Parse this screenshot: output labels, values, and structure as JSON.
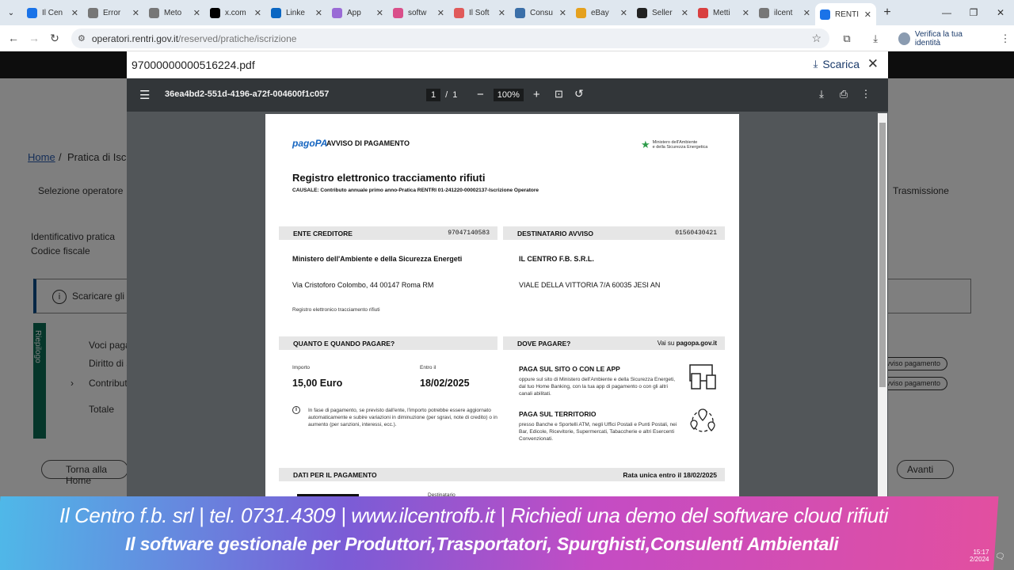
{
  "browser": {
    "tabs": [
      {
        "label": "Il Cen",
        "icon": "globe-icon",
        "color": "#1a73e8"
      },
      {
        "label": "Error",
        "icon": "globe-icon",
        "color": "#777777"
      },
      {
        "label": "Meto",
        "icon": "globe-icon",
        "color": "#777777"
      },
      {
        "label": "x.com",
        "icon": "x-logo-icon",
        "color": "#000000"
      },
      {
        "label": "Linke",
        "icon": "linkedin-icon",
        "color": "#0a66c2"
      },
      {
        "label": "App",
        "icon": "app-icon",
        "color": "#9a6bd6"
      },
      {
        "label": "softw",
        "icon": "flag-icon",
        "color": "#d94f8a"
      },
      {
        "label": "Il Soft",
        "icon": "search-icon",
        "color": "#e05a5a"
      },
      {
        "label": "Consu",
        "icon": "wordpress-icon",
        "color": "#3b6fa8"
      },
      {
        "label": "eBay",
        "icon": "ebay-icon",
        "color": "#e5a11e"
      },
      {
        "label": "Seller",
        "icon": "amazon-icon",
        "color": "#222222"
      },
      {
        "label": "Metti",
        "icon": "pin-icon",
        "color": "#d94040"
      },
      {
        "label": "ilcent",
        "icon": "globe-icon",
        "color": "#777777"
      },
      {
        "label": "RENTI",
        "icon": "link-icon",
        "color": "#1a73e8",
        "active": true
      }
    ],
    "url_host": "operatori.rentri.gov.it",
    "url_path": "/reserved/pratiche/iscrizione",
    "verify_label": "Verifica la tua identità"
  },
  "background_page": {
    "breadcrumb_home": "Home",
    "breadcrumb_current": "Pratica di Iscr",
    "step_1": "Selezione operatore",
    "step_last": "Trasmissione",
    "field_1": "Identificativo pratica",
    "field_2": "Codice fiscale",
    "info_text": "Scaricare gli a",
    "side_tab": "Riepilogo",
    "row_1": "Voci paga",
    "row_2": "Diritto di s",
    "row_3": "Contribut",
    "row_4": "Totale",
    "pill_1": "vviso pagamento",
    "pill_2": "vviso pagamento",
    "back_btn": "Torna alla Home",
    "next_btn": "Avanti"
  },
  "viewer": {
    "filename": "97000000000516224.pdf",
    "download_label": "Scarica",
    "doc_id": "36ea4bd2-551d-4196-a72f-004600f1c057",
    "page_current": "1",
    "page_total": "1",
    "zoom": "100%"
  },
  "document": {
    "logo": "pagoPA",
    "header_title": "AVVISO DI PAGAMENTO",
    "ministry_line1": "Ministero dell'Ambiente",
    "ministry_line2": "e della Sicurezza Energetica",
    "title": "Registro elettronico tracciamento rifiuti",
    "causale": "CAUSALE: Contributo annuale primo anno-Pratica RENTRI 01-241220-00002137-Iscrizione Operatore",
    "creditor_label": "ENTE CREDITORE",
    "creditor_code": "97047140583",
    "recipient_label": "DESTINATARIO AVVISO",
    "recipient_code": "01560430421",
    "creditor_name": "Ministero dell'Ambiente e della Sicurezza Energeti",
    "creditor_address": "Via Cristoforo Colombo, 44 00147 Roma RM",
    "creditor_note": "Registro elettronico tracciamento rifiuti",
    "recipient_name": "IL CENTRO F.B. S.R.L.",
    "recipient_address": "VIALE DELLA VITTORIA 7/A 60035 JESI AN",
    "when_label": "QUANTO E QUANDO PAGARE?",
    "where_label": "DOVE PAGARE?",
    "where_hint": "Vai su ",
    "where_site": "pagopa.gov.it",
    "amount_label": "Importo",
    "amount_value": "15,00 Euro",
    "due_label": "Entro il",
    "due_value": "18/02/2025",
    "info_note": "In fase di pagamento, se previsto dall'ente, l'importo potrebbe essere aggiornato automaticamente e subire variazioni in diminuzione (per sgravi, note di credito) o in aumento (per sanzioni, interessi, ecc.).",
    "app_title": "PAGA SUL SITO O CON LE APP",
    "app_text": "oppure sul sito di Ministero dell'Ambiente e della Sicurezza Energeti, dal tuo Home Banking, con la tua app di pagamento o con gli altri canali abilitati.",
    "territory_title": "PAGA SUL TERRITORIO",
    "territory_text": "presso Banche e Sportelli ATM, negli Uffici Postali e Punti Postali, nei Bar, Edicole, Ricevitorie, Supermercati, Tabaccherie e altri Esercenti Convenzionati.",
    "data_label": "DATI PER IL PAGAMENTO",
    "data_right": "Rata unica entro il 18/02/2025",
    "data_sub": "Destinatario"
  },
  "banner": {
    "line1": "Il Centro f.b. srl | tel. 0731.4309 | www.ilcentrofb.it | Richiedi una demo del software cloud rifiuti",
    "line2": "Il software gestionale per Produttori,Trasportatori, Spurghisti,Consulenti Ambientali"
  },
  "taskbar": {
    "time": "15:17",
    "date": "2/2024"
  }
}
